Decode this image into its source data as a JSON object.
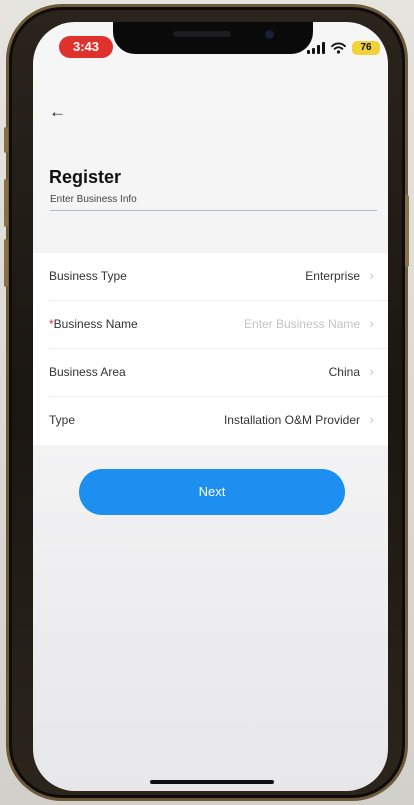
{
  "status_bar": {
    "time": "3:43",
    "battery": "76",
    "signal_icon": "signal-bars-icon",
    "wifi_icon": "wifi-icon"
  },
  "header": {
    "back_icon": "arrow-left-icon",
    "back_glyph": "←",
    "title": "Register",
    "subtitle": "Enter Business Info"
  },
  "form": {
    "rows": [
      {
        "label": "Business Type",
        "required": false,
        "value": "Enterprise",
        "placeholder": false
      },
      {
        "label": "Business Name",
        "required": true,
        "required_mark": "*",
        "value": "Enter Business Name",
        "placeholder": true
      },
      {
        "label": "Business Area",
        "required": false,
        "value": "China",
        "placeholder": false
      },
      {
        "label": "Type",
        "required": false,
        "value": "Installation O&M Provider",
        "placeholder": false
      }
    ],
    "chevron_glyph": "›"
  },
  "next_button": {
    "label": "Next"
  },
  "colors": {
    "accent": "#1c8ff0",
    "required": "#e0322c",
    "time_pill": "#e0322c",
    "battery": "#f0d23a"
  }
}
